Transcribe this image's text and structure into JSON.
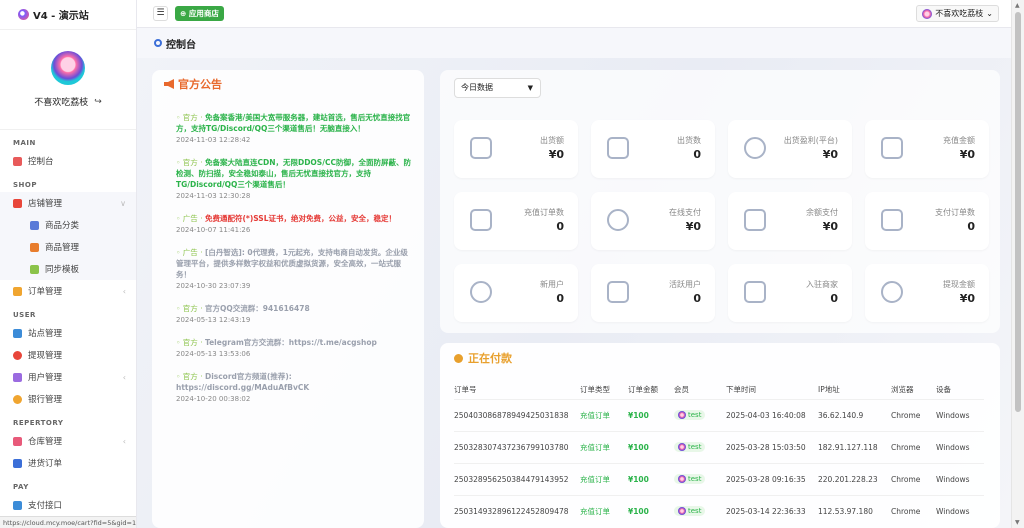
{
  "brand": {
    "title": "V4 - 演示站"
  },
  "user": {
    "name": "不喜欢吃荔枝",
    "logout_icon": "logout-icon"
  },
  "sidebar": {
    "sections": [
      {
        "label": "MAIN"
      },
      {
        "label": "SHOP"
      },
      {
        "label": "USER"
      },
      {
        "label": "REPERTORY"
      },
      {
        "label": "PAY"
      }
    ],
    "items": {
      "dashboard": "控制台",
      "shop_manage": "店铺管理",
      "product_category": "商品分类",
      "product_manage": "商品管理",
      "sync_template": "同步模板",
      "order_manage": "订单管理",
      "site_manage": "站点管理",
      "withdraw_manage": "提现管理",
      "user_manage": "用户管理",
      "bank_manage": "银行管理",
      "warehouse_manage": "仓库管理",
      "purchase_order": "进货订单",
      "pay_interface": "支付接口"
    }
  },
  "status_url": "https://cloud.mcy.moe/cart?fid=5&gid=18",
  "topbar": {
    "app_store": "应用商店",
    "user_label": "不喜欢吃荔枝"
  },
  "page": {
    "title": "控制台"
  },
  "announcement": {
    "title": "官方公告",
    "items": [
      {
        "tag": "◦ 官方 · ",
        "text": "免备案香港/美国大宽带服务器，建站首选，售后无忧直接找官方，支持TG/Discord/QQ三个渠道售后！无脑直接入！",
        "time": "2024-11-03 12:28:42",
        "style": "green"
      },
      {
        "tag": "◦ 官方 · ",
        "text": "免备案大陆直连CDN，无限DDOS/CC防御，全面防屏蔽、防检测、防扫描，安全稳如泰山，售后无忧直接找官方，支持TG/Discord/QQ三个渠道售后！",
        "time": "2024-11-03 12:30:28",
        "style": "green"
      },
      {
        "tag": "◦ 广告 · ",
        "text": "免费通配符(*)SSL证书，绝对免费，公益，安全，稳定！",
        "time": "2024-10-07 11:41:26",
        "style": "red"
      },
      {
        "tag": "◦ 广告 · ",
        "text": "[白丹智选]: 0代理费，1元起充，支持电商自动发货。企业级管理平台，提供多样数字权益和优质虚拟货源，安全高效，一站式服务！",
        "time": "2024-10-30 23:07:39",
        "style": "grey"
      },
      {
        "tag": "◦ 官方 · ",
        "text": "官方QQ交流群：941616478",
        "time": "2024-05-13 12:43:19",
        "style": "grey"
      },
      {
        "tag": "◦ 官方 · ",
        "text": "Telegram官方交流群：https://t.me/acgshop",
        "time": "2024-05-13 13:53:06",
        "style": "grey"
      },
      {
        "tag": "◦ 官方 · ",
        "text": "Discord官方频道(推荐): https://discord.gg/MAduAfBvCK",
        "time": "2024-10-20 00:38:02",
        "style": "grey"
      }
    ]
  },
  "stats": {
    "range": "今日数据",
    "tiles": [
      {
        "label": "出货额",
        "value": "¥0"
      },
      {
        "label": "出货数",
        "value": "0"
      },
      {
        "label": "出货盈利(平台)",
        "value": "¥0"
      },
      {
        "label": "充值金额",
        "value": "¥0"
      },
      {
        "label": "充值订单数",
        "value": "0"
      },
      {
        "label": "在线支付",
        "value": "¥0"
      },
      {
        "label": "余额支付",
        "value": "¥0"
      },
      {
        "label": "支付订单数",
        "value": "0"
      },
      {
        "label": "新用户",
        "value": "0"
      },
      {
        "label": "活跃用户",
        "value": "0"
      },
      {
        "label": "入驻商家",
        "value": "0"
      },
      {
        "label": "提现金额",
        "value": "¥0"
      }
    ]
  },
  "orders": {
    "title": "正在付款",
    "columns": [
      "订单号",
      "订单类型",
      "订单金额",
      "会员",
      "下单时间",
      "IP地址",
      "浏览器",
      "设备"
    ],
    "rows": [
      {
        "no": "250403086878949425031838",
        "type": "充值订单",
        "amount": "¥100",
        "member": "test",
        "time": "2025-04-03 16:40:08",
        "ip": "36.62.140.9",
        "browser": "Chrome",
        "device": "Windows"
      },
      {
        "no": "250328307437236799103780",
        "type": "充值订单",
        "amount": "¥100",
        "member": "test",
        "time": "2025-03-28 15:03:50",
        "ip": "182.91.127.118",
        "browser": "Chrome",
        "device": "Windows"
      },
      {
        "no": "250328956250384479143952",
        "type": "充值订单",
        "amount": "¥100",
        "member": "test",
        "time": "2025-03-28 09:16:35",
        "ip": "220.201.228.23",
        "browser": "Chrome",
        "device": "Windows"
      },
      {
        "no": "250314932896122452809478",
        "type": "充值订单",
        "amount": "¥100",
        "member": "test",
        "time": "2025-03-14 22:36:33",
        "ip": "112.53.97.180",
        "browser": "Chrome",
        "device": "Windows"
      }
    ]
  }
}
